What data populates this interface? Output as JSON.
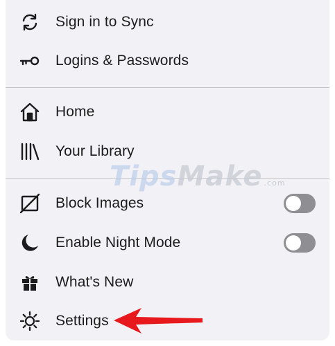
{
  "menu": {
    "items": [
      {
        "label": "Sign in to Sync",
        "icon": "sync-icon"
      },
      {
        "label": "Logins & Passwords",
        "icon": "key-icon"
      },
      {
        "label": "Home",
        "icon": "home-icon"
      },
      {
        "label": "Your Library",
        "icon": "library-icon"
      },
      {
        "label": "Block Images",
        "icon": "block-images-icon",
        "toggle": "off"
      },
      {
        "label": "Enable Night Mode",
        "icon": "moon-icon",
        "toggle": "off"
      },
      {
        "label": "What's New",
        "icon": "gift-icon"
      },
      {
        "label": "Settings",
        "icon": "gear-icon"
      }
    ]
  },
  "watermark": {
    "part1": "Tips",
    "part2": "Make",
    "part3": ".com"
  },
  "annotation": {
    "arrow_color": "#e8191c",
    "points_to": "Settings"
  },
  "colors": {
    "menu_background": "#f2f2f6",
    "text": "#1c1c1e",
    "divider": "#c6c6c8",
    "toggle_off": "#8e8e93"
  }
}
